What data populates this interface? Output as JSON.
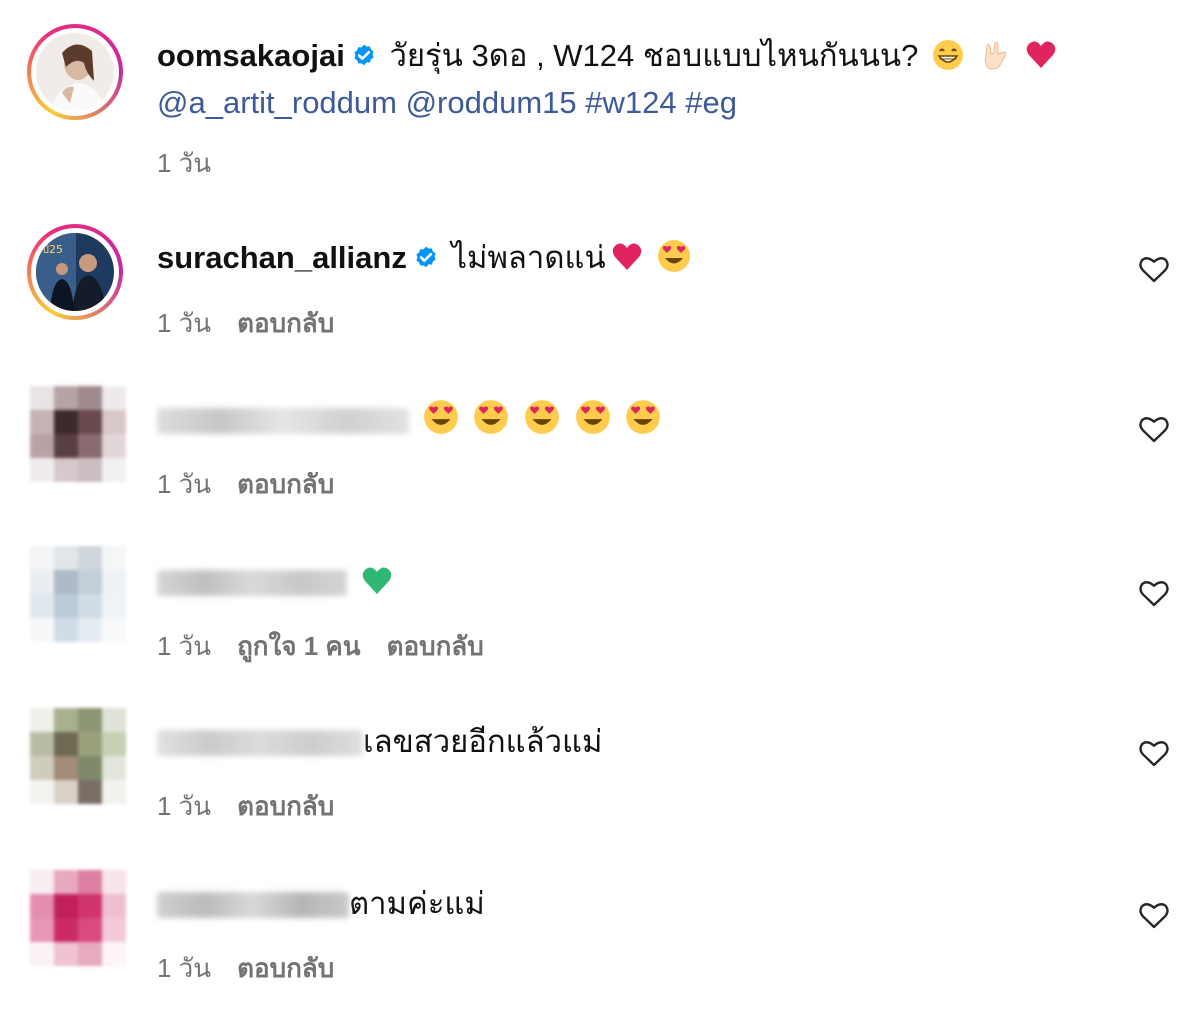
{
  "post": {
    "username": "oomsakaojai",
    "caption": "วัยรุ่น 3ดอ , W124 ชอบแบบไหนกันนน?",
    "mentions": "@a_artit_roddum @roddum15 #w124 #eg",
    "time": "1 วัน"
  },
  "comments": [
    {
      "username": "surachan_allianz",
      "text": "ไม่พลาดแน่",
      "time": "1 วัน",
      "reply": "ตอบกลับ"
    },
    {
      "username": "",
      "text": "",
      "time": "1 วัน",
      "reply": "ตอบกลับ"
    },
    {
      "username": "",
      "text": "",
      "time": "1 วัน",
      "likes": "ถูกใจ 1 คน",
      "reply": "ตอบกลับ"
    },
    {
      "username": "",
      "text": "เลขสวยอีกแล้วแม่",
      "time": "1 วัน",
      "reply": "ตอบกลับ"
    },
    {
      "username": "",
      "text": "ตามค่ะแม่",
      "time": "1 วัน",
      "reply": "ตอบกลับ"
    }
  ],
  "colors": {
    "link": "#3d5a99",
    "muted": "#737373",
    "verified": "#0095f6"
  },
  "icons": [
    "verified-badge-icon",
    "heart-outline-icon",
    "grin-emoji-icon",
    "rock-hand-emoji-icon",
    "red-heart-emoji-icon",
    "heart-eyes-emoji-icon",
    "green-heart-emoji-icon"
  ]
}
